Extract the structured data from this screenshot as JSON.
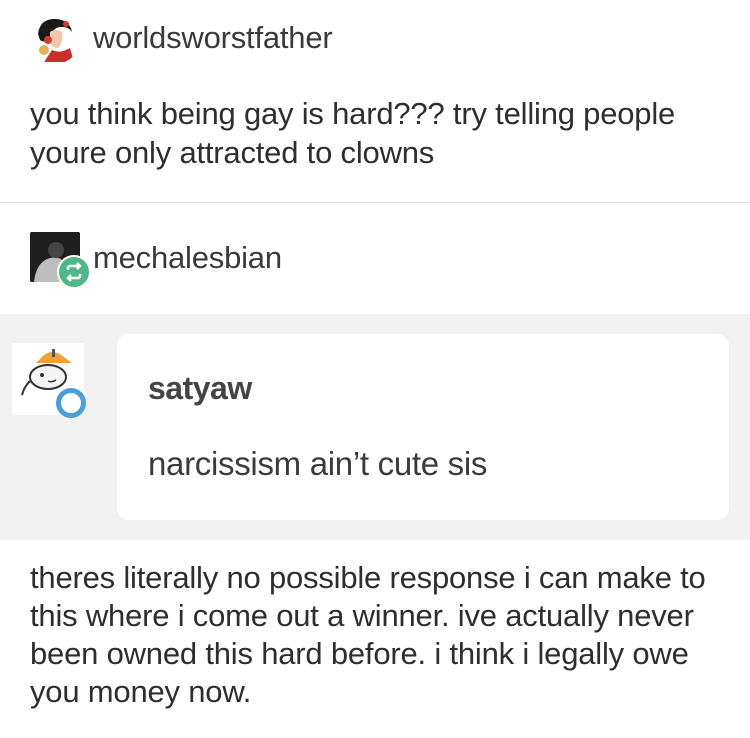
{
  "posts": [
    {
      "username": "worldsworstfather",
      "avatar_icon": "pinup-woman-avatar-icon",
      "text": "you think being gay is hard??? try telling people youre only attracted to clowns"
    },
    {
      "username": "mechalesbian",
      "avatar_icon": "dark-photo-avatar-icon",
      "badge_icon": "reblog-icon",
      "quoted": {
        "username": "satyaw",
        "avatar_icon": "cartoon-cat-avatar-icon",
        "text": "narcissism ain’t cute sis"
      },
      "text": "theres literally no possible response i can make to this where i come out a winner. ive actually never been owned this hard before. i think i legally owe you money now."
    }
  ],
  "colors": {
    "reblog_badge": "#50b786",
    "quote_background": "#f1f1f1",
    "quote_badge_ring": "#4a9fd8"
  }
}
